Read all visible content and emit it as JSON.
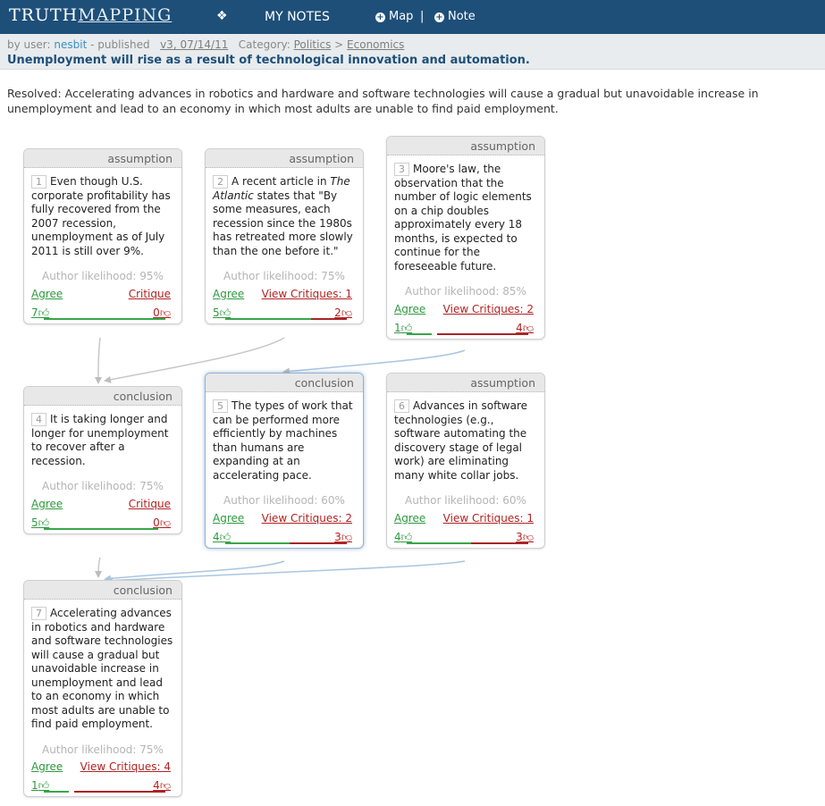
{
  "nav": {
    "logo_part1": "TRUTH",
    "logo_part2": "MAPPING",
    "home_icon": "home-icon",
    "my_notes": "MY NOTES",
    "map": "Map",
    "separator": "|",
    "note": "Note"
  },
  "meta": {
    "by_user_prefix": "by user:",
    "username": "nesbit",
    "status": "- published",
    "version": "v3, 07/14/11",
    "category_label": "Category:",
    "category": "Politics",
    "category_sep": ">",
    "subcategory": "Economics",
    "title": "Unemployment will rise as a result of technological innovation and automation."
  },
  "resolved": "Resolved: Accelerating advances in robotics and hardware and software technologies will cause a gradual but unavoidable increase in unemployment and lead to an economy in which most adults are unable to find paid employment.",
  "colors": {
    "nav_bg": "#1d4f79",
    "agree": "#2e9a3e",
    "critique": "#b22222",
    "arrow": "#a9c6e0"
  },
  "cards": [
    {
      "type": "assumption",
      "num": "1",
      "text": "Even though U.S. corporate profitability has fully recovered from the 2007 recession, unemployment as of July 2011 is still over 9%.",
      "likelihood": "Author likelihood: 95%",
      "agree": "Agree",
      "critique": "Critique",
      "up": "7",
      "down": "0",
      "agree_share": 1.0
    },
    {
      "type": "assumption",
      "num": "2",
      "text_before": "A recent article in ",
      "text_italic": "The Atlantic",
      "text_after": " states that \"By some measures, each recession since the 1980s has retreated more slowly than the one before it.\"",
      "likelihood": "Author likelihood: 75%",
      "agree": "Agree",
      "critique": "View Critiques: 1",
      "up": "5",
      "down": "2",
      "agree_share": 0.71
    },
    {
      "type": "assumption",
      "num": "3",
      "text": "Moore's law, the observation that the number of logic elements on a chip doubles approximately every 18 months, is expected to continue for the foreseeable future.",
      "likelihood": "Author likelihood: 85%",
      "agree": "Agree",
      "critique": "View Critiques: 2",
      "up": "1",
      "down": "4",
      "agree_share": 0.2
    },
    {
      "type": "conclusion",
      "num": "4",
      "text": "It is taking longer and longer for unemployment to recover after a recession.",
      "likelihood": "Author likelihood: 75%",
      "agree": "Agree",
      "critique": "Critique",
      "up": "5",
      "down": "0",
      "agree_share": 1.0
    },
    {
      "type": "conclusion",
      "num": "5",
      "text": "The types of work that can be performed more efficiently by machines than humans are expanding at an accelerating pace.",
      "likelihood": "Author likelihood: 60%",
      "agree": "Agree",
      "critique": "View Critiques: 2",
      "up": "4",
      "down": "3",
      "agree_share": 0.57
    },
    {
      "type": "assumption",
      "num": "6",
      "text": "Advances in software technologies (e.g., software automating the discovery stage of legal work) are eliminating many white collar jobs.",
      "likelihood": "Author likelihood: 60%",
      "agree": "Agree",
      "critique": "View Critiques: 1",
      "up": "4",
      "down": "3",
      "agree_share": 0.57
    },
    {
      "type": "conclusion",
      "num": "7",
      "text": "Accelerating advances in robotics and hardware and software technologies will cause a gradual but unavoidable increase in unemployment and lead to an economy in which most adults are unable to find paid employment.",
      "likelihood": "Author likelihood: 75%",
      "agree": "Agree",
      "critique": "View Critiques: 4",
      "up": "1",
      "down": "4",
      "agree_share": 0.2
    }
  ]
}
